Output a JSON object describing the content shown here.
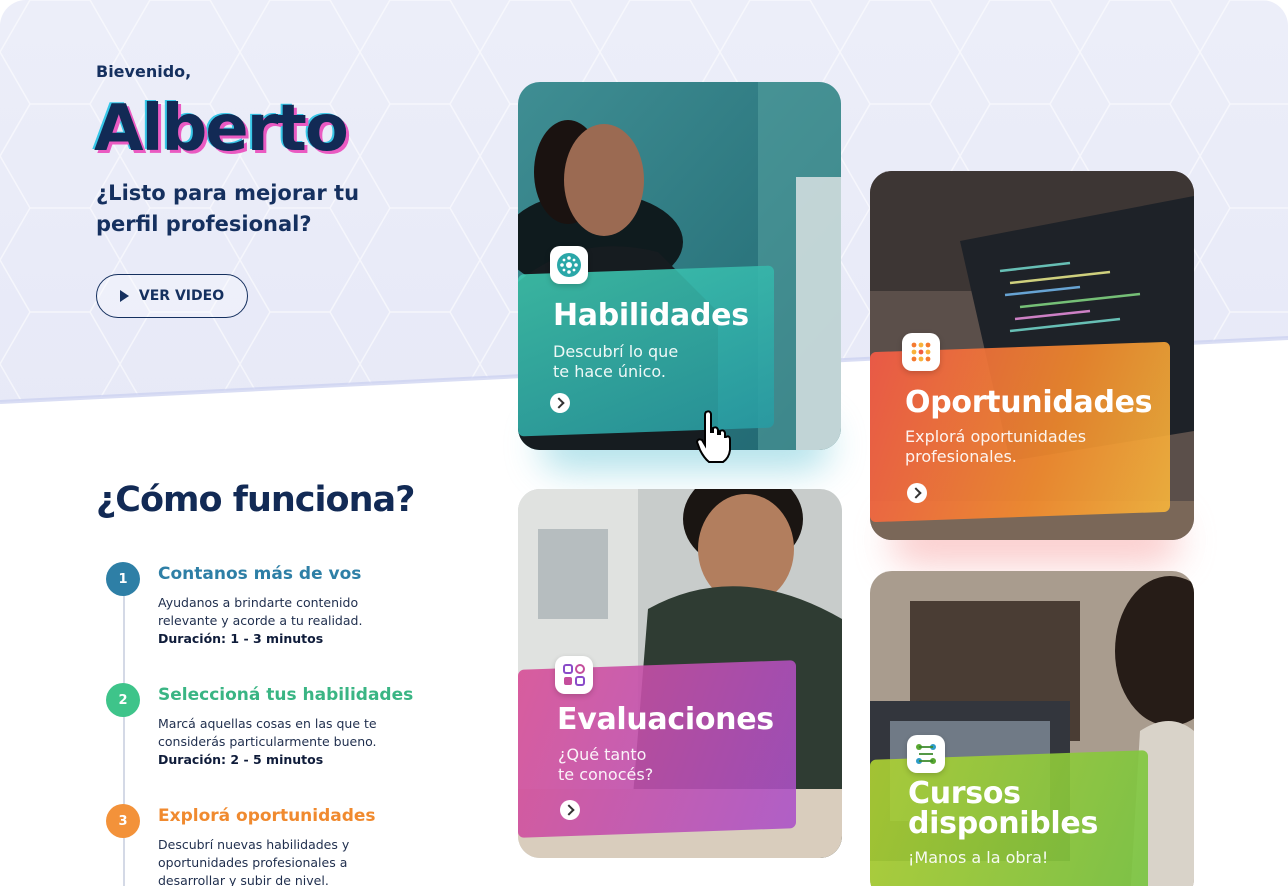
{
  "hero": {
    "greeting": "Bievenido,",
    "user_name": "Alberto",
    "tagline": "¿Listo para mejorar tu perfil profesional?",
    "video_button": "VER VIDEO"
  },
  "how_it_works": {
    "title": "¿Cómo funciona?",
    "steps": [
      {
        "number": "1",
        "title": "Contanos más de vos",
        "description": "Ayudanos a brindarte contenido relevante y acorde a tu realidad.",
        "duration": "Duración: 1 - 3 minutos",
        "color": "#2e7fa6"
      },
      {
        "number": "2",
        "title": "Seleccioná tus habilidades",
        "description": "Marcá aquellas cosas en las que te considerás particularmente bueno.",
        "duration": "Duración: 2 - 5 minutos",
        "color": "#3ec48a"
      },
      {
        "number": "3",
        "title": "Explorá oportunidades",
        "description": "Descubrí nuevas habilidades y oportunidades profesionales a desarrollar y subir de nivel.",
        "duration": "",
        "color": "#f3923a"
      }
    ]
  },
  "cards": [
    {
      "title": "Habilidades",
      "subtitle_line1": "Descubrí lo que",
      "subtitle_line2": "te hace único.",
      "icon": "network-icon",
      "accent": "#2fb5a6"
    },
    {
      "title": "Oportunidades",
      "subtitle_line1": "Explorá oportunidades",
      "subtitle_line2": "profesionales.",
      "icon": "dots-grid-icon",
      "accent": "#f47a2f"
    },
    {
      "title": "Evaluaciones",
      "subtitle_line1": "¿Qué tanto",
      "subtitle_line2": "te conocés?",
      "icon": "shapes-icon",
      "accent": "#c05ab8"
    },
    {
      "title_line1": "Cursos",
      "title_line2": "disponibles",
      "subtitle_line1": "¡Manos a la obra!",
      "icon": "connect-icon",
      "accent": "#8ac43a"
    }
  ]
}
